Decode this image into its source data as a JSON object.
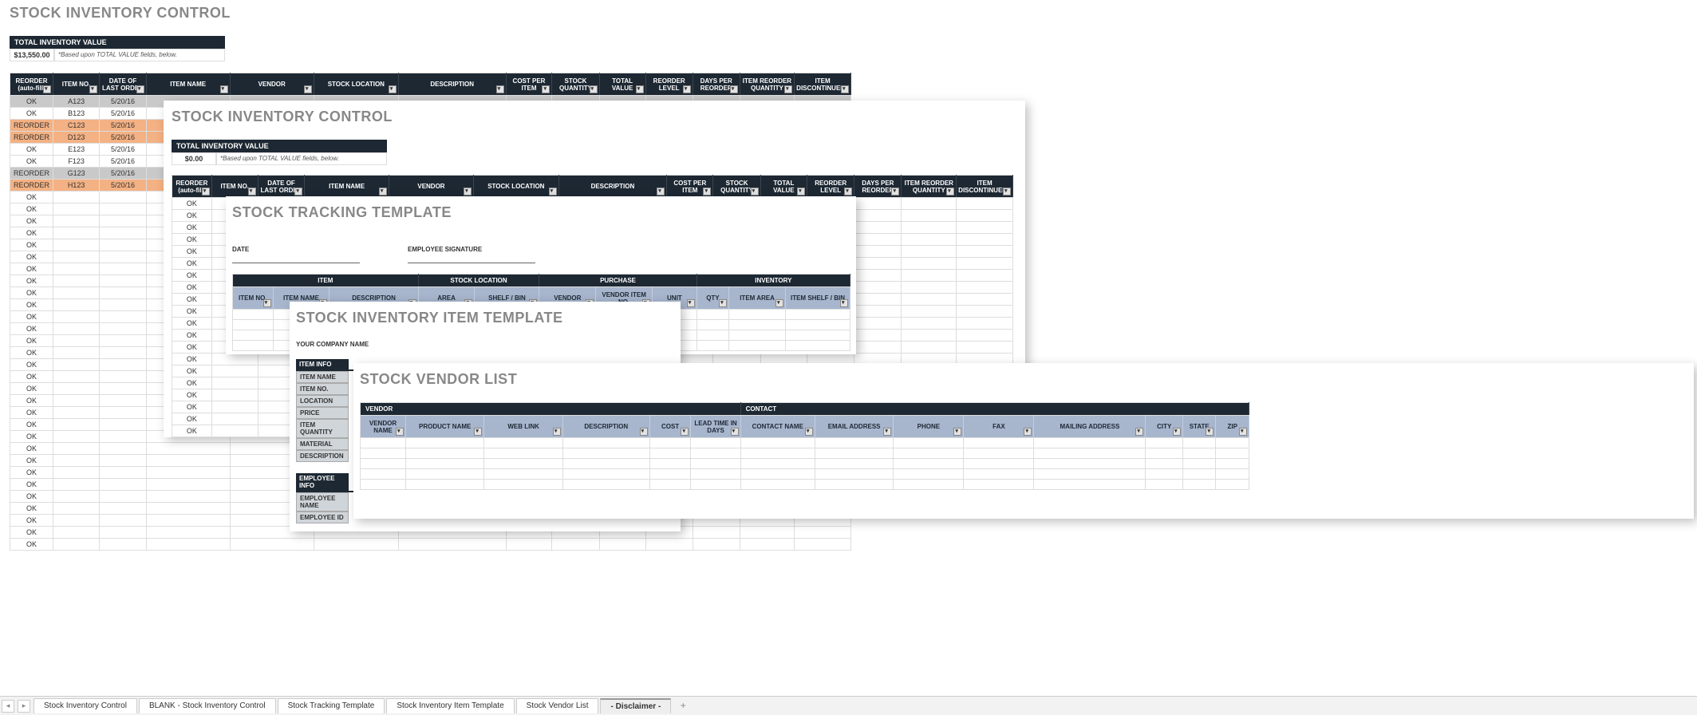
{
  "panel1": {
    "title": "STOCK INVENTORY CONTROL",
    "total_label": "TOTAL INVENTORY VALUE",
    "total_value": "$13,550.00",
    "total_note": "*Based upon TOTAL VALUE fields, below.",
    "headers": [
      "REORDER (auto-fill)",
      "ITEM NO.",
      "DATE OF LAST ORDER",
      "ITEM NAME",
      "VENDOR",
      "STOCK LOCATION",
      "DESCRIPTION",
      "COST PER ITEM",
      "STOCK QUANTITY",
      "TOTAL VALUE",
      "REORDER LEVEL",
      "DAYS PER REORDER",
      "ITEM REORDER QUANTITY",
      "ITEM DISCONTINUED?"
    ],
    "rows": [
      {
        "r": "OK",
        "item": "A123",
        "date": "5/20/16",
        "cls": "row-grey"
      },
      {
        "r": "OK",
        "item": "B123",
        "date": "5/20/16",
        "cls": "row-ok"
      },
      {
        "r": "REORDER",
        "item": "C123",
        "date": "5/20/16",
        "cls": "row-orange"
      },
      {
        "r": "REORDER",
        "item": "D123",
        "date": "5/20/16",
        "cls": "row-orange"
      },
      {
        "r": "OK",
        "item": "E123",
        "date": "5/20/16",
        "cls": "row-ok"
      },
      {
        "r": "OK",
        "item": "F123",
        "date": "5/20/16",
        "cls": "row-ok"
      },
      {
        "r": "REORDER",
        "item": "G123",
        "date": "5/20/16",
        "cls": "row-grey"
      },
      {
        "r": "REORDER",
        "item": "H123",
        "date": "5/20/16",
        "cls": "row-orange"
      }
    ],
    "ok_label": "OK",
    "empty_ok_rows": 30
  },
  "panel2": {
    "title": "STOCK INVENTORY CONTROL",
    "total_label": "TOTAL INVENTORY VALUE",
    "total_value": "$0.00",
    "total_note": "*Based upon TOTAL VALUE fields, below.",
    "headers": [
      "REORDER (auto-fill)",
      "ITEM NO.",
      "DATE OF LAST ORDER",
      "ITEM NAME",
      "VENDOR",
      "STOCK LOCATION",
      "DESCRIPTION",
      "COST PER ITEM",
      "STOCK QUANTITY",
      "TOTAL VALUE",
      "REORDER LEVEL",
      "DAYS PER REORDER",
      "ITEM REORDER QUANTITY",
      "ITEM DISCONTINUED?"
    ],
    "ok_label": "OK",
    "empty_ok_rows": 20
  },
  "panel3": {
    "title": "STOCK TRACKING TEMPLATE",
    "date_label": "DATE",
    "sig_label": "EMPLOYEE SIGNATURE",
    "group_headers": [
      "ITEM",
      "STOCK LOCATION",
      "PURCHASE",
      "INVENTORY"
    ],
    "sub_headers": [
      "ITEM NO.",
      "ITEM NAME",
      "DESCRIPTION",
      "AREA",
      "SHELF / BIN",
      "VENDOR",
      "VENDOR ITEM NO.",
      "UNIT",
      "QTY",
      "ITEM AREA",
      "ITEM SHELF / BIN"
    ]
  },
  "panel4": {
    "title": "STOCK INVENTORY ITEM TEMPLATE",
    "company_label": "YOUR COMPANY NAME",
    "item_info": "ITEM INFO",
    "item_fields": [
      "ITEM NAME",
      "ITEM NO.",
      "LOCATION",
      "PRICE",
      "ITEM QUANTITY",
      "MATERIAL",
      "DESCRIPTION"
    ],
    "emp_info": "EMPLOYEE INFO",
    "emp_fields": [
      "EMPLOYEE NAME",
      "EMPLOYEE ID"
    ]
  },
  "panel5": {
    "title": "STOCK VENDOR LIST",
    "group_headers": [
      "VENDOR",
      "CONTACT"
    ],
    "sub_headers": [
      "VENDOR NAME",
      "PRODUCT NAME",
      "WEB LINK",
      "DESCRIPTION",
      "COST",
      "LEAD TIME IN DAYS",
      "CONTACT NAME",
      "EMAIL ADDRESS",
      "PHONE",
      "FAX",
      "MAILING ADDRESS",
      "CITY",
      "STATE",
      "ZIP"
    ]
  },
  "tabs": [
    "Stock Inventory Control",
    "BLANK - Stock Inventory Control",
    "Stock Tracking Template",
    "Stock Inventory Item Template",
    "Stock Vendor List",
    "- Disclaimer -"
  ]
}
